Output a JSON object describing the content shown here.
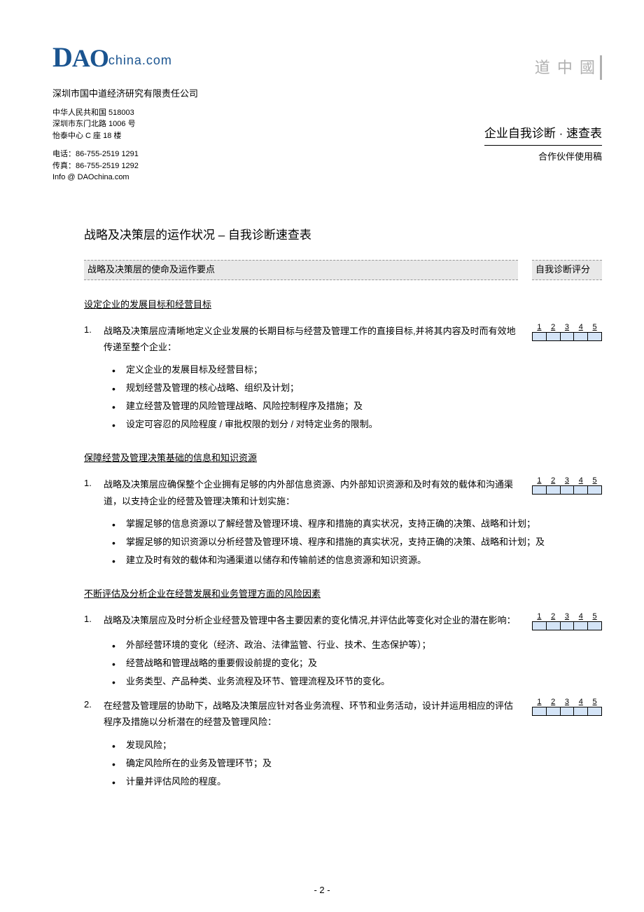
{
  "header": {
    "logo_main": "DAO",
    "logo_suffix": "china.com",
    "brand_mark": "道 中 國",
    "company": "深圳市国中道经济研究有限责任公司",
    "address": {
      "line1": "中华人民共和国 518003",
      "line2": "深圳市东门北路 1006 号",
      "line3": "怡泰中心 C 座 18 楼"
    },
    "contact": {
      "phone": "电话：86-755-2519 1291",
      "fax": "传真：86-755-2519 1292",
      "email": "Info @ DAOchina.com"
    },
    "doc_title": "企业自我诊断 · 速查表",
    "doc_subtitle": "合作伙伴使用稿"
  },
  "body": {
    "section_title": "战略及决策层的运作状况 – 自我诊断速查表",
    "heading_left": "战略及决策层的使命及运作要点",
    "heading_right": "自我诊断评分",
    "score_labels": [
      "1",
      "2",
      "3",
      "4",
      "5"
    ],
    "sub1": {
      "title": "设定企业的发展目标和经营目标",
      "item1_num": "1.",
      "item1_text": "战略及决策层应清晰地定义企业发展的长期目标与经营及管理工作的直接目标,并将其内容及时而有效地传递至整个企业：",
      "bullets": [
        "定义企业的发展目标及经营目标；",
        "规划经营及管理的核心战略、组织及计划；",
        "建立经营及管理的风险管理战略、风险控制程序及措施；及",
        "设定可容忍的风险程度 / 审批权限的划分 / 对特定业务的限制。"
      ]
    },
    "sub2": {
      "title": "保障经营及管理决策基础的信息和知识资源",
      "item1_num": "1.",
      "item1_text": "战略及决策层应确保整个企业拥有足够的内外部信息资源、内外部知识资源和及时有效的载体和沟通渠道，以支持企业的经营及管理决策和计划实施：",
      "bullets": [
        "掌握足够的信息资源以了解经营及管理环境、程序和措施的真实状况，支持正确的决策、战略和计划；",
        "掌握足够的知识资源以分析经营及管理环境、程序和措施的真实状况，支持正确的决策、战略和计划；及",
        "建立及时有效的载体和沟通渠道以储存和传输前述的信息资源和知识资源。"
      ]
    },
    "sub3": {
      "title": "不断评估及分析企业在经营发展和业务管理方面的风险因素",
      "item1_num": "1.",
      "item1_text": "战略及决策层应及时分析企业经营及管理中各主要因素的变化情况,并评估此等变化对企业的潜在影响：",
      "bullets1": [
        "外部经营环境的变化（经济、政治、法律监管、行业、技术、生态保护等）；",
        "经营战略和管理战略的重要假设前提的变化；及",
        "业务类型、产品种类、业务流程及环节、管理流程及环节的变化。"
      ],
      "item2_num": "2.",
      "item2_text": "在经营及管理层的协助下，战略及决策层应针对各业务流程、环节和业务活动，设计并运用相应的评估程序及措施以分析潜在的经营及管理风险：",
      "bullets2": [
        "发现风险；",
        "确定风险所在的业务及管理环节；及",
        "计量并评估风险的程度。"
      ]
    }
  },
  "page_number": "- 2 -"
}
